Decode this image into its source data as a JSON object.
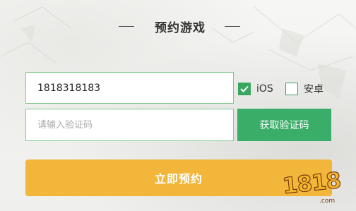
{
  "title": "预约游戏",
  "phone_input": {
    "value": "1818318183",
    "placeholder": ""
  },
  "code_input": {
    "value": "",
    "placeholder": "请输入验证码"
  },
  "platforms": {
    "ios": {
      "label": "iOS",
      "checked": true
    },
    "android": {
      "label": "安卓",
      "checked": false
    }
  },
  "buttons": {
    "get_code": "获取验证码",
    "reserve": "立即预约"
  },
  "watermark": {
    "logo_text": "1818",
    "sub_text": ".com"
  },
  "colors": {
    "accent_green": "#3aae69",
    "field_border": "#7fc88e",
    "reserve_orange": "#f1b63a",
    "title_text": "#333333"
  },
  "icons": {
    "checkbox_checked": "checkmark-icon",
    "checkbox_unchecked": "empty-checkbox-icon"
  }
}
